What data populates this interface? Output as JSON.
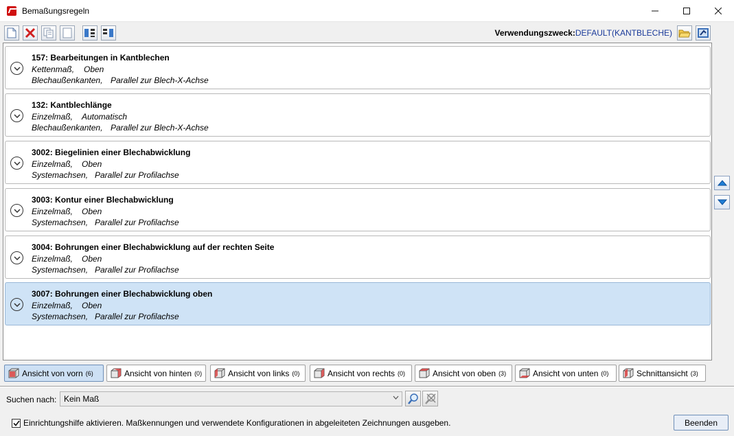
{
  "window": {
    "title": "Bemaßungsregeln",
    "controls": [
      "minimize-icon",
      "maximize-icon",
      "close-icon"
    ]
  },
  "toolbar": {
    "buttons": [
      "new-document-icon",
      "delete-icon",
      "copy-icon",
      "paste-icon",
      "move-down-icon",
      "move-up-icon"
    ],
    "usage_label": "Verwendungszweck:",
    "usage_value": "DEFAULT(KANTBLECHE)",
    "right_buttons": [
      "open-folder-icon",
      "settings-icon"
    ]
  },
  "rules": [
    {
      "title": "157: Bearbeitungen in Kantblechen",
      "l1a": "Kettenmaß,",
      "l1b": "Oben",
      "l2a": "Blechaußenkanten,",
      "l2b": "Parallel zur Blech-X-Achse",
      "selected": false
    },
    {
      "title": "132: Kantblechlänge",
      "l1a": "Einzelmaß,",
      "l1b": "Automatisch",
      "l2a": "Blechaußenkanten,",
      "l2b": "Parallel zur Blech-X-Achse",
      "selected": false
    },
    {
      "title": "3002: Biegelinien einer Blechabwicklung",
      "l1a": "Einzelmaß,",
      "l1b": "Oben",
      "l2a": "Systemachsen,",
      "l2b": "Parallel zur Profilachse",
      "selected": false
    },
    {
      "title": "3003: Kontur einer Blechabwicklung",
      "l1a": "Einzelmaß,",
      "l1b": "Oben",
      "l2a": "Systemachsen,",
      "l2b": "Parallel zur Profilachse",
      "selected": false
    },
    {
      "title": "3004: Bohrungen einer Blechabwicklung auf der rechten Seite",
      "l1a": "Einzelmaß,",
      "l1b": "Oben",
      "l2a": "Systemachsen,",
      "l2b": "Parallel zur Profilachse",
      "selected": false
    },
    {
      "title": "3007: Bohrungen einer Blechabwicklung oben",
      "l1a": "Einzelmaß,",
      "l1b": "Oben",
      "l2a": "Systemachsen,",
      "l2b": "Parallel zur Profilachse",
      "selected": true
    }
  ],
  "tabs": [
    {
      "label": "Ansicht von vorn",
      "count": "(6)",
      "active": true
    },
    {
      "label": "Ansicht von hinten",
      "count": "(0)",
      "active": false
    },
    {
      "label": "Ansicht von links",
      "count": "(0)",
      "active": false
    },
    {
      "label": "Ansicht von rechts",
      "count": "(0)",
      "active": false
    },
    {
      "label": "Ansicht von oben",
      "count": "(3)",
      "active": false
    },
    {
      "label": "Ansicht von unten",
      "count": "(0)",
      "active": false
    },
    {
      "label": "Schnittansicht",
      "count": "(3)",
      "active": false
    }
  ],
  "search": {
    "label": "Suchen nach:",
    "value": "Kein Maß"
  },
  "footer": {
    "checkbox_label": "Einrichtungshilfe aktivieren. Maßkennungen und verwendete Konfigurationen in abgeleiteten Zeichnungen ausgeben.",
    "checkbox_checked": true,
    "end_label": "Beenden"
  },
  "colors": {
    "selected_row": "#cfe3f6",
    "active_tab": "#cde0f4",
    "usage_value": "#1a3a9a",
    "arrow_blue": "#1f7fd6"
  }
}
